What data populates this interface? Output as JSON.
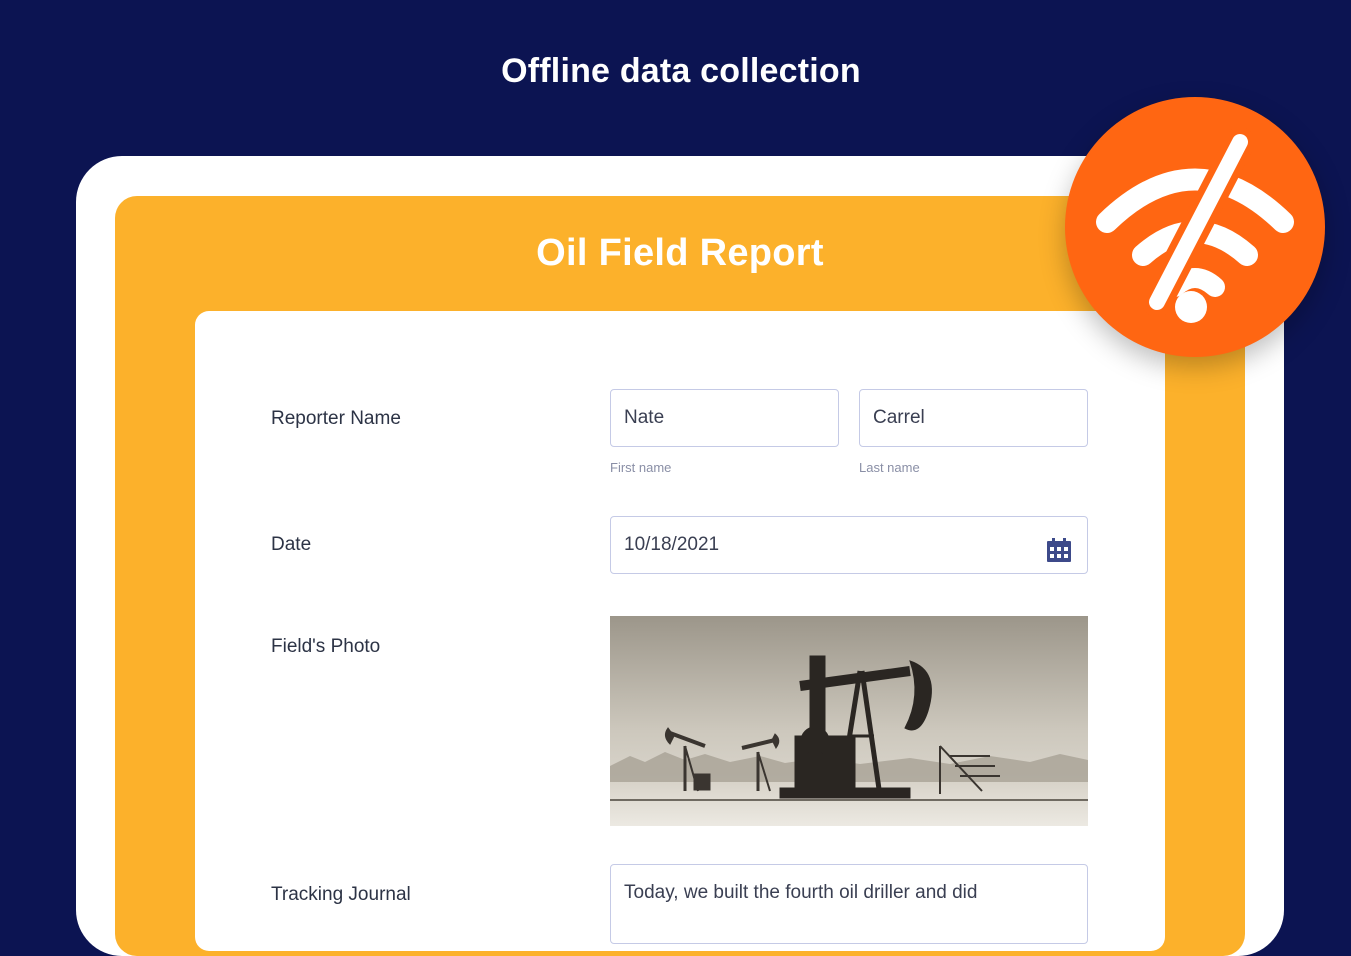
{
  "headline": "Offline data collection",
  "form": {
    "title": "Oil Field Report",
    "reporter_name": {
      "label": "Reporter Name",
      "first_value": "Nate",
      "first_sublabel": "First name",
      "last_value": "Carrel",
      "last_sublabel": "Last name"
    },
    "date": {
      "label": "Date",
      "value": "10/18/2021"
    },
    "photo": {
      "label": "Field's Photo"
    },
    "journal": {
      "label": "Tracking Journal",
      "value": "Today, we built the fourth oil driller and did"
    }
  },
  "icons": {
    "calendar": "calendar-icon",
    "offline": "wifi-off-icon"
  },
  "colors": {
    "background": "#0c1452",
    "form_accent": "#fcb12b",
    "offline_badge": "#ff6612",
    "input_border": "#c5cae6",
    "calendar_icon": "#3d4a8a"
  }
}
